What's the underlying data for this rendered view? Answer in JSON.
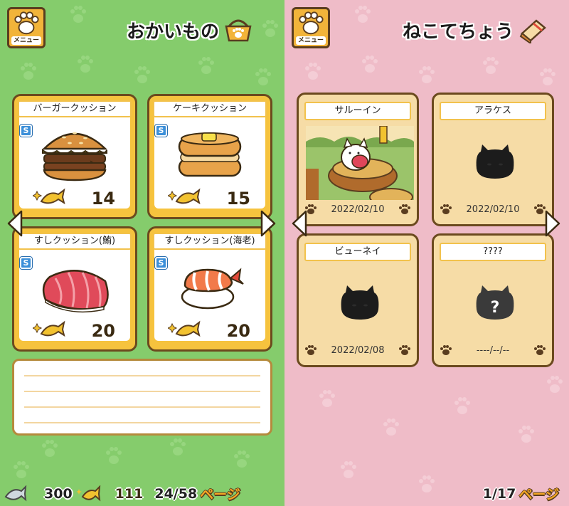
{
  "left_panel": {
    "menu_label": "メニュー",
    "title": "おかいもの",
    "items": [
      {
        "name": "バーガークッション",
        "badge": "S",
        "price": "14",
        "icon": "burger-cushion"
      },
      {
        "name": "ケーキクッション",
        "badge": "S",
        "price": "15",
        "icon": "pancake-cushion"
      },
      {
        "name": "すしクッション(鮪)",
        "badge": "S",
        "price": "20",
        "icon": "tuna-sushi-cushion"
      },
      {
        "name": "すしクッション(海老)",
        "badge": "S",
        "price": "20",
        "icon": "shrimp-sushi-cushion"
      }
    ],
    "currency": {
      "silver_fish": "300",
      "gold_fish": "111"
    },
    "page": "24/58",
    "page_word": "ページ"
  },
  "right_panel": {
    "menu_label": "メニュー",
    "title": "ねこてちょう",
    "cats": [
      {
        "name": "サルーイン",
        "date": "2022/02/10"
      },
      {
        "name": "アラケス",
        "date": "2022/02/10"
      },
      {
        "name": "ビューネイ",
        "date": "2022/02/08"
      },
      {
        "name": "????",
        "date": "----/--/--"
      }
    ],
    "page": "1/17",
    "page_word": "ページ"
  },
  "colors": {
    "left_bg": "#85cc6c",
    "right_bg": "#efbcc8",
    "card_gold": "#f6c33e",
    "card_cream": "#f6dca6",
    "outline_brown": "#6b4a1e"
  }
}
